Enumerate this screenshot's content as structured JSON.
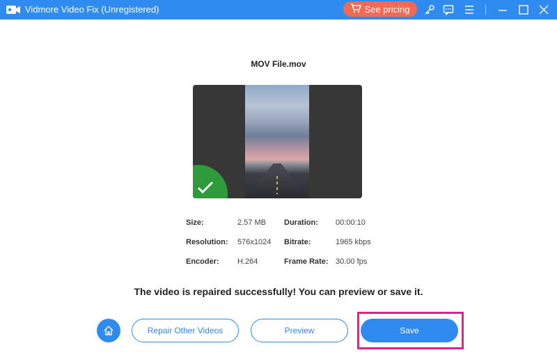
{
  "window": {
    "title": "Vidmore Video Fix (Unregistered)",
    "pricing_label": "See pricing",
    "icons": [
      "cart-icon",
      "key-icon",
      "feedback-icon",
      "menu-icon",
      "minimize-icon",
      "maximize-icon",
      "close-icon"
    ]
  },
  "file": {
    "name": "MOV File.mov"
  },
  "details": {
    "size_label": "Size:",
    "size_value": "2.57 MB",
    "duration_label": "Duration:",
    "duration_value": "00:00:10",
    "resolution_label": "Resolution:",
    "resolution_value": "576x1024",
    "bitrate_label": "Bitrate:",
    "bitrate_value": "1965 kbps",
    "encoder_label": "Encoder:",
    "encoder_value": "H.264",
    "framerate_label": "Frame Rate:",
    "framerate_value": "30.00 fps"
  },
  "message": "The video is repaired successfully! You can preview or save it.",
  "actions": {
    "repair_other": "Repair Other Videos",
    "preview": "Preview",
    "save": "Save"
  },
  "colors": {
    "accent": "#2f8bf0",
    "pricing": "#f26a55",
    "success": "#2e9b3a",
    "highlight": "#e6208a"
  }
}
